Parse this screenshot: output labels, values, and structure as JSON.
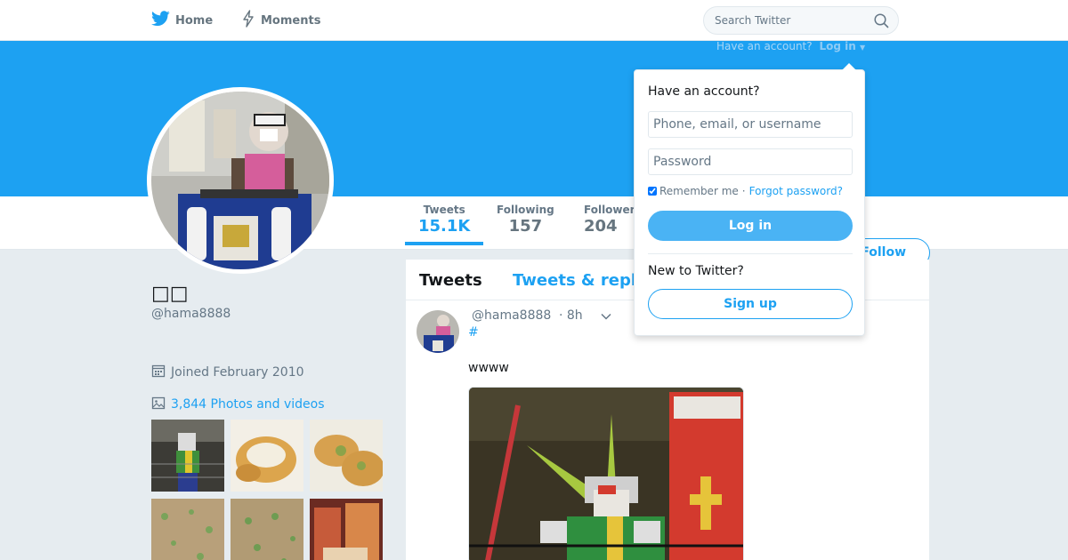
{
  "nav": {
    "home_label": "Home",
    "moments_label": "Moments",
    "search_placeholder": "Search Twitter",
    "have_account": "Have an account?",
    "login_link": "Log in"
  },
  "profile": {
    "display_name": "□□",
    "screen_name": "@hama8888",
    "joined": "Joined February 2010",
    "photos_videos": "3,844 Photos and videos"
  },
  "stats": [
    {
      "label": "Tweets",
      "value": "15.1K",
      "active": true
    },
    {
      "label": "Following",
      "value": "157",
      "active": false
    },
    {
      "label": "Followers",
      "value": "204",
      "active": false
    }
  ],
  "follow_button": "Follow",
  "timeline": {
    "tabs": [
      "Tweets",
      "Tweets & replies"
    ],
    "tweet": {
      "handle": "@hama8888",
      "time": "· 8h",
      "hashtag": "#",
      "text": "wwww"
    }
  },
  "login_popup": {
    "title": "Have an account?",
    "username_placeholder": "Phone, email, or username",
    "password_placeholder": "Password",
    "remember_me": "Remember me",
    "separator": "·",
    "forgot_password": "Forgot password?",
    "login_button": "Log in",
    "new_to_twitter": "New to Twitter?",
    "signup_button": "Sign up"
  },
  "colors": {
    "accent": "#1da1f2",
    "background": "#e6ecf0",
    "banner": "#1da1f2"
  },
  "icons": [
    "twitter-bird-icon",
    "lightning-icon",
    "search-icon",
    "calendar-icon",
    "photo-icon",
    "chevron-down-icon"
  ]
}
